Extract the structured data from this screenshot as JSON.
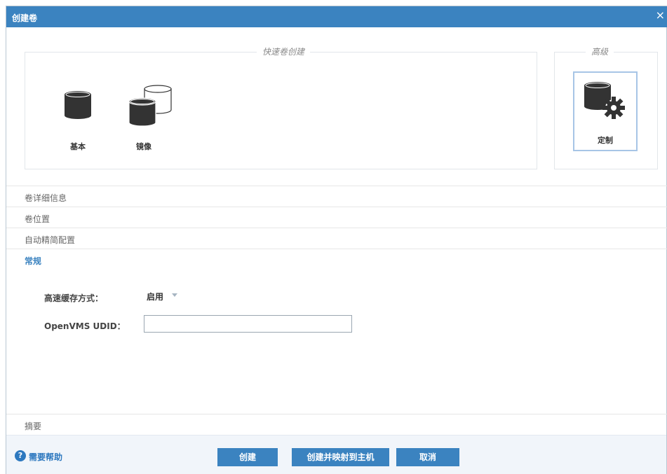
{
  "dialog": {
    "title": "创建卷",
    "close_glyph": "×"
  },
  "quick_create": {
    "legend": "快速卷创建",
    "options": [
      {
        "label": "基本",
        "icon": "database-icon"
      },
      {
        "label": "镜像",
        "icon": "mirrored-database-icon"
      }
    ]
  },
  "advanced": {
    "legend": "高级",
    "option": {
      "label": "定制",
      "icon": "database-gear-icon",
      "selected": true
    }
  },
  "sections": [
    {
      "label": "卷详细信息",
      "active": false
    },
    {
      "label": "卷位置",
      "active": false
    },
    {
      "label": "自动精简配置",
      "active": false
    },
    {
      "label": "常规",
      "active": true
    }
  ],
  "general_form": {
    "cache_label": "高速缓存方式：",
    "cache_value": "启用",
    "udid_label": "OpenVMS UDID：",
    "udid_value": ""
  },
  "summary": {
    "label": "摘要"
  },
  "footer": {
    "help_glyph": "?",
    "help_label": "需要帮助",
    "create_label": "创建",
    "create_map_label": "创建并映射到主机",
    "cancel_label": "取消"
  },
  "colors": {
    "accent": "#3b83c0",
    "footer_bg": "#f1f5fa",
    "selected_border": "#a7c5e6"
  }
}
